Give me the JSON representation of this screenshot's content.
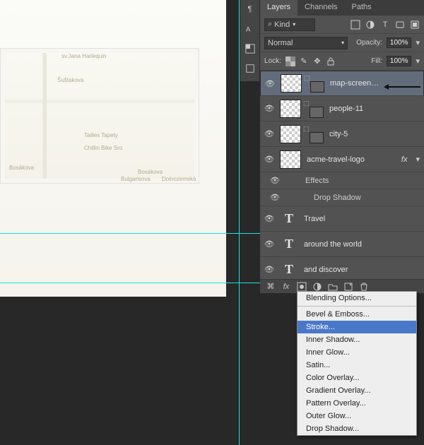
{
  "tabs": {
    "layers": "Layers",
    "channels": "Channels",
    "paths": "Paths"
  },
  "filter": {
    "kind": "Kind"
  },
  "blend": {
    "mode": "Normal",
    "opacity_label": "Opacity:",
    "opacity": "100%"
  },
  "lock": {
    "label": "Lock:",
    "fill_label": "Fill:",
    "fill": "100%"
  },
  "layers": [
    {
      "name": "map-screen…",
      "type": "smart",
      "selected": true
    },
    {
      "name": "people-11",
      "type": "smart"
    },
    {
      "name": "city-5",
      "type": "smart"
    },
    {
      "name": "acme-travel-logo",
      "type": "smart",
      "fx": true
    },
    {
      "name": "Travel",
      "type": "text"
    },
    {
      "name": "around the world",
      "type": "text"
    },
    {
      "name": "and discover",
      "type": "text"
    }
  ],
  "effects": {
    "label": "Effects",
    "items": [
      "Drop Shadow"
    ]
  },
  "fx_menu": [
    "Blending Options...",
    "Bevel & Emboss...",
    "Stroke...",
    "Inner Shadow...",
    "Inner Glow...",
    "Satin...",
    "Color Overlay...",
    "Gradient Overlay...",
    "Pattern Overlay...",
    "Outer Glow...",
    "Drop Shadow..."
  ],
  "fx_menu_highlight": "Stroke...",
  "map_labels": [
    "sv.Jana Harlequin",
    "Šuštakova",
    "Tailles Tapety",
    "Chillin Bike Sro",
    "Bosákova",
    "Bosákova",
    "Bulgarisova",
    "Dolnozemská"
  ],
  "search_icon": "⌕"
}
